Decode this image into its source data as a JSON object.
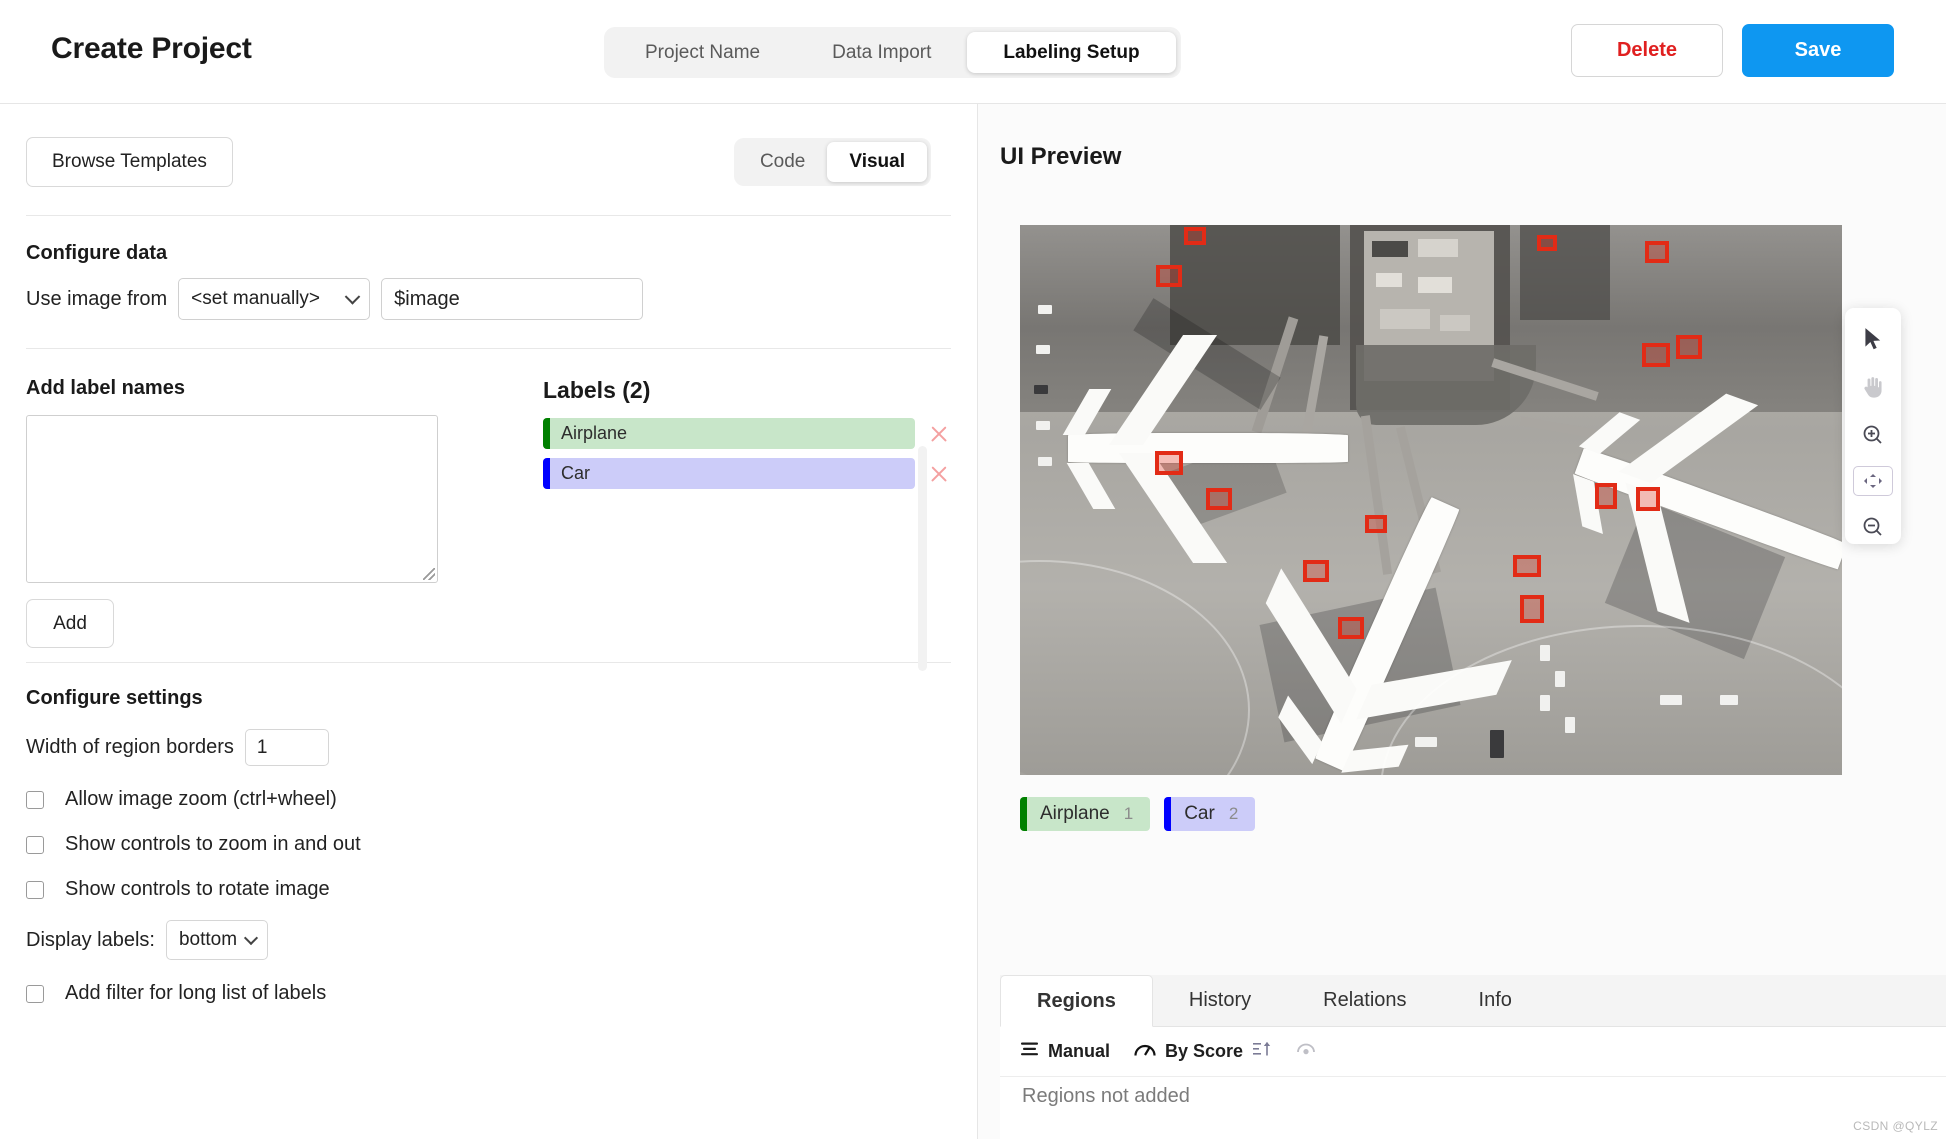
{
  "header": {
    "title": "Create Project",
    "tabs": [
      {
        "label": "Project Name",
        "active": false
      },
      {
        "label": "Data Import",
        "active": false
      },
      {
        "label": "Labeling Setup",
        "active": true
      }
    ],
    "delete_label": "Delete",
    "save_label": "Save",
    "accent_blue": "#0e97f1",
    "danger_red": "#e02020"
  },
  "left": {
    "browse_templates_label": "Browse Templates",
    "view_toggle": {
      "code_label": "Code",
      "visual_label": "Visual",
      "selected": "Visual"
    },
    "configure_data": {
      "title": "Configure data",
      "use_image_from_label": "Use image from",
      "source_select_value": "<set manually>",
      "value_input_value": "$image",
      "value_input_placeholder": "$image"
    },
    "add_labels": {
      "title": "Add label names",
      "textarea_value": "",
      "textarea_placeholder": "",
      "add_button_label": "Add"
    },
    "labels_panel": {
      "title": "Labels (2)",
      "items": [
        {
          "name": "Airplane",
          "color": "#008000",
          "background": "#c8e6c9"
        },
        {
          "name": "Car",
          "color": "#0000ff",
          "background": "#ccccf9"
        }
      ]
    },
    "configure_settings": {
      "title": "Configure settings",
      "region_border_label": "Width of region borders",
      "region_border_value": "1",
      "checkboxes": [
        {
          "label": "Allow image zoom (ctrl+wheel)",
          "checked": false
        },
        {
          "label": "Show controls to zoom in and out",
          "checked": false
        },
        {
          "label": "Show controls to rotate image",
          "checked": false
        }
      ],
      "display_labels_label": "Display labels:",
      "display_labels_value": "bottom",
      "filter_checkbox": {
        "label": "Add filter for long list of labels",
        "checked": false
      }
    }
  },
  "right": {
    "preview_title": "UI Preview",
    "image_alt": "aerial-view-of-airport-terminal-with-three-parked-airplanes",
    "label_badges": [
      {
        "name": "Airplane",
        "hotkey": "1",
        "color": "#008000",
        "background": "#c8e6c9"
      },
      {
        "name": "Car",
        "hotkey": "2",
        "color": "#0000ff",
        "background": "#ccccf9"
      }
    ],
    "toolbar_icons": [
      "cursor-icon",
      "hand-icon",
      "zoom-in-icon",
      "fit-to-screen-icon",
      "zoom-out-icon"
    ],
    "bottom_tabs": [
      {
        "label": "Regions",
        "active": true
      },
      {
        "label": "History",
        "active": false
      },
      {
        "label": "Relations",
        "active": false
      },
      {
        "label": "Info",
        "active": false
      }
    ],
    "sort_bar": {
      "manual_label": "Manual",
      "by_score_label": "By Score"
    },
    "regions_empty_text": "Regions not added"
  },
  "watermark": "CSDN @QYLZ"
}
